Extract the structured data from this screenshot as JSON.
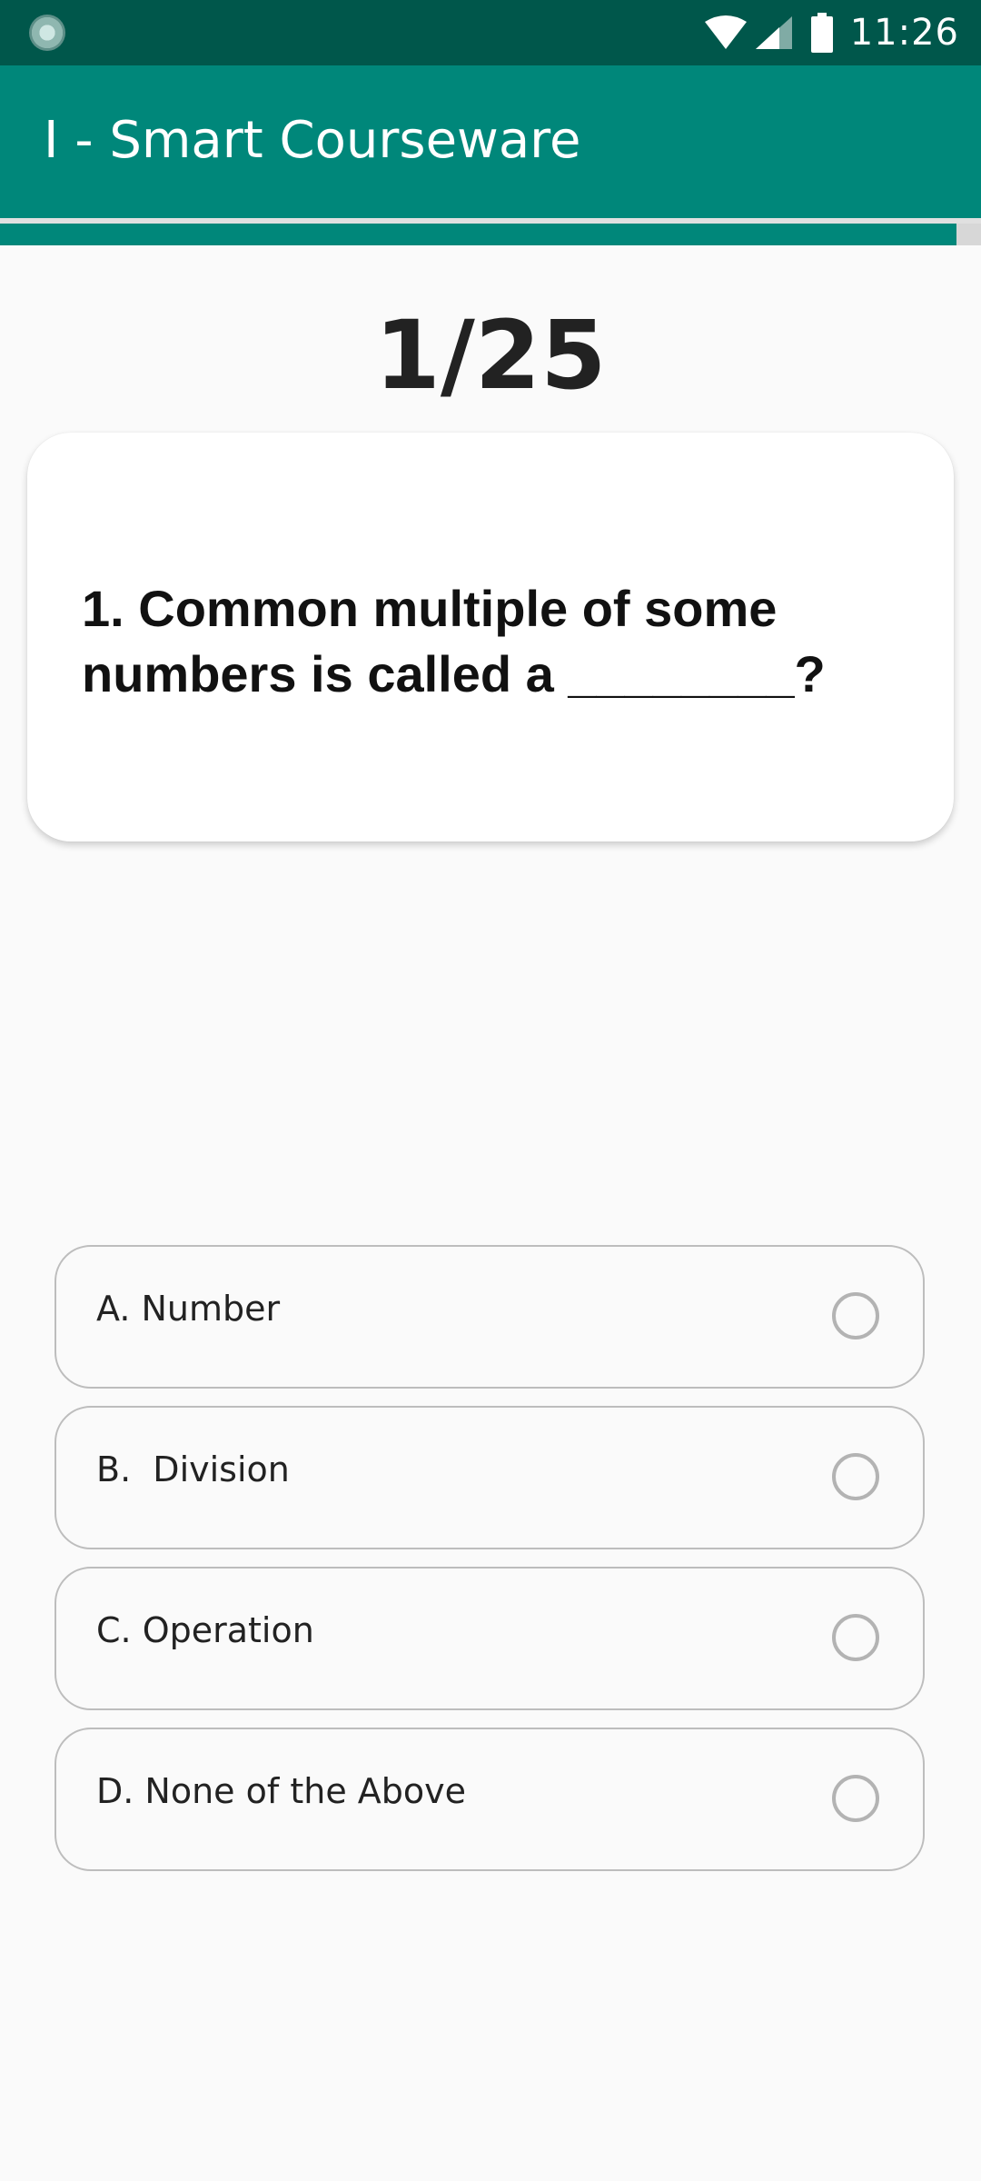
{
  "status_bar": {
    "time": "11:26",
    "icons": [
      "app-notification-icon",
      "wifi-icon",
      "signal-icon",
      "battery-icon"
    ]
  },
  "app_bar": {
    "title": "I - Smart Courseware",
    "color": "#00877a"
  },
  "quiz": {
    "progress_fraction": 0.975,
    "counter": "1/25",
    "question": "1. Common multiple of some numbers is called a ________?",
    "options": [
      {
        "label": "A. Number",
        "selected": false
      },
      {
        "label": "B.  Division",
        "selected": false
      },
      {
        "label": "C. Operation",
        "selected": false
      },
      {
        "label": "D. None of the Above",
        "selected": false
      }
    ]
  },
  "colors": {
    "status_bar": "#00574b",
    "accent": "#00877a",
    "background": "#fafafa"
  }
}
